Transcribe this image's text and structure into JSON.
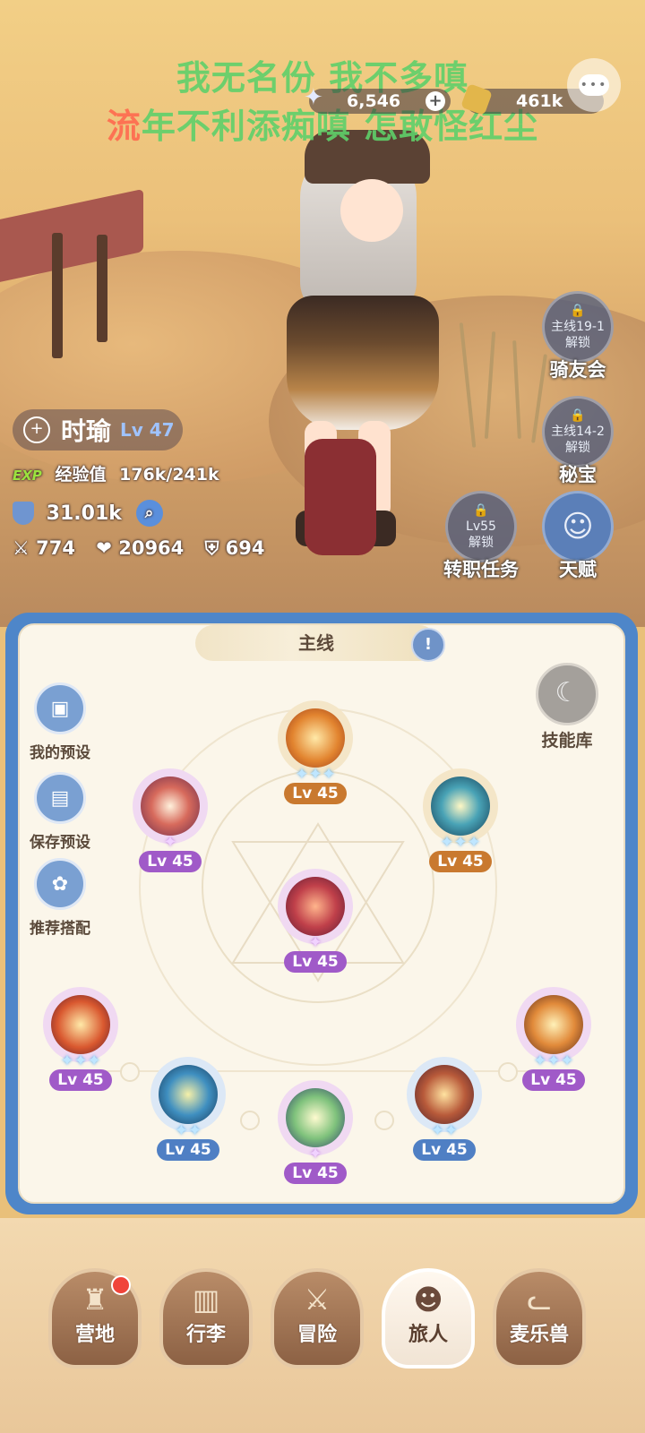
{
  "lyrics": {
    "line1": "我无名份 我不多嗔",
    "line2_red": "流",
    "line2_rest": "年不利添痴嗔 怎敢怪红尘"
  },
  "resources": {
    "crystal": "6,546",
    "add": "+",
    "gold": "461k"
  },
  "side_buttons": [
    {
      "lock_text": "主线19-1\n解锁",
      "label": "骑友会"
    },
    {
      "lock_text": "主线14-2\n解锁",
      "label": "秘宝"
    },
    {
      "lock_text": "Lv55\n解锁",
      "label": "转职任务"
    },
    {
      "label": "天赋"
    }
  ],
  "character": {
    "name": "时瑜",
    "level": "Lv 47",
    "exp_badge": "EXP",
    "exp_label": "经验值",
    "exp_value": "176k/241k",
    "power": "31.01k",
    "attack": "774",
    "hp": "20964",
    "defense": "694"
  },
  "panel": {
    "tab": "主线",
    "skill_library": "技能库",
    "left_buttons": [
      "我的预设",
      "保存预设",
      "推荐搭配"
    ]
  },
  "skills": [
    {
      "level": "Lv 45",
      "badge": "orange",
      "stars": "blue3"
    },
    {
      "level": "Lv 45",
      "badge": "purple",
      "stars": "pink1"
    },
    {
      "level": "Lv 45",
      "badge": "orange",
      "stars": "blue3"
    },
    {
      "level": "Lv 45",
      "badge": "purple",
      "stars": "pink1"
    },
    {
      "level": "Lv 45",
      "badge": "purple",
      "stars": "blue3"
    },
    {
      "level": "Lv 45",
      "badge": "blue",
      "stars": "blue2"
    },
    {
      "level": "Lv 45",
      "badge": "purple",
      "stars": "pink1"
    },
    {
      "level": "Lv 45",
      "badge": "blue",
      "stars": "blue2"
    },
    {
      "level": "Lv 45",
      "badge": "purple",
      "stars": "blue3"
    }
  ],
  "nav": [
    {
      "label": "营地",
      "icon": "castle-icon"
    },
    {
      "label": "行李",
      "icon": "backpack-icon"
    },
    {
      "label": "冒险",
      "icon": "crossed-swords-icon"
    },
    {
      "label": "旅人",
      "icon": "character-icon"
    },
    {
      "label": "麦乐兽",
      "icon": "cat-icon"
    }
  ]
}
